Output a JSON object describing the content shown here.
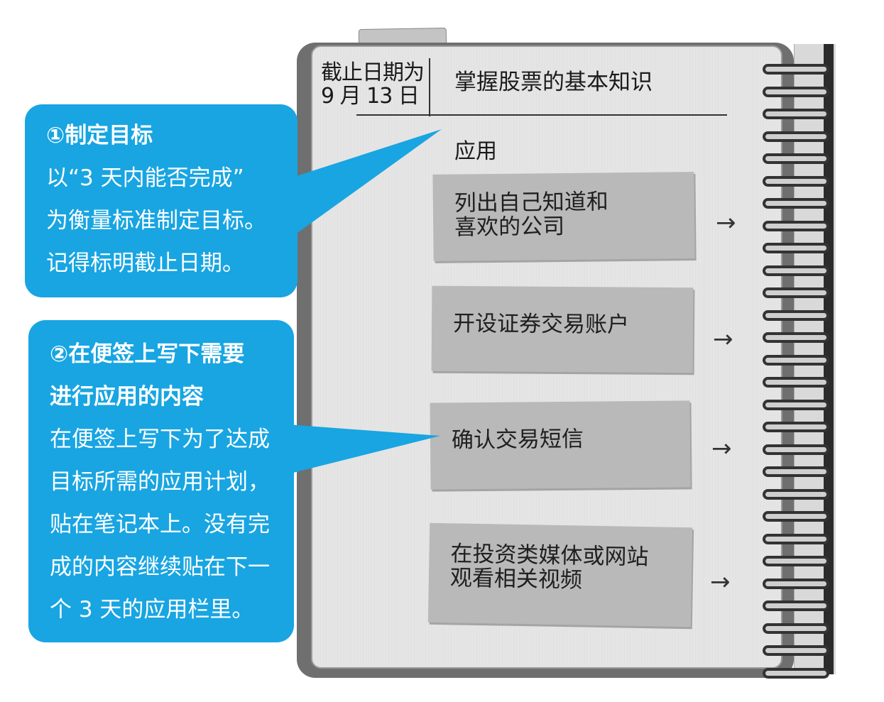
{
  "notebook": {
    "deadline_line1": "截止日期为",
    "deadline_line2": "9 月 13 日",
    "goal": "掌握股票的基本知识",
    "apply_heading": "应用",
    "notes": [
      {
        "lines": [
          "列出自己知道和",
          "喜欢的公司"
        ]
      },
      {
        "lines": [
          "开设证券交易账户"
        ]
      },
      {
        "lines": [
          "确认交易短信"
        ]
      },
      {
        "lines": [
          "在投资类媒体或网站",
          "观看相关视频"
        ]
      }
    ],
    "arrow": "→"
  },
  "callouts": [
    {
      "title_lines": [
        "①制定目标"
      ],
      "body_lines": [
        "以“3 天内能否完成”",
        "为衡量标准制定目标。",
        "记得标明截止日期。"
      ],
      "color": "#18a5e2"
    },
    {
      "title_lines": [
        "②在便签上写下需要",
        "进行应用的内容"
      ],
      "body_lines": [
        "在便签上写下为了达成",
        "目标所需的应用计划，",
        "贴在笔记本上。没有完",
        "成的内容继续贴在下一",
        "个 3 天的应用栏里。"
      ],
      "color": "#18a5e2"
    }
  ]
}
